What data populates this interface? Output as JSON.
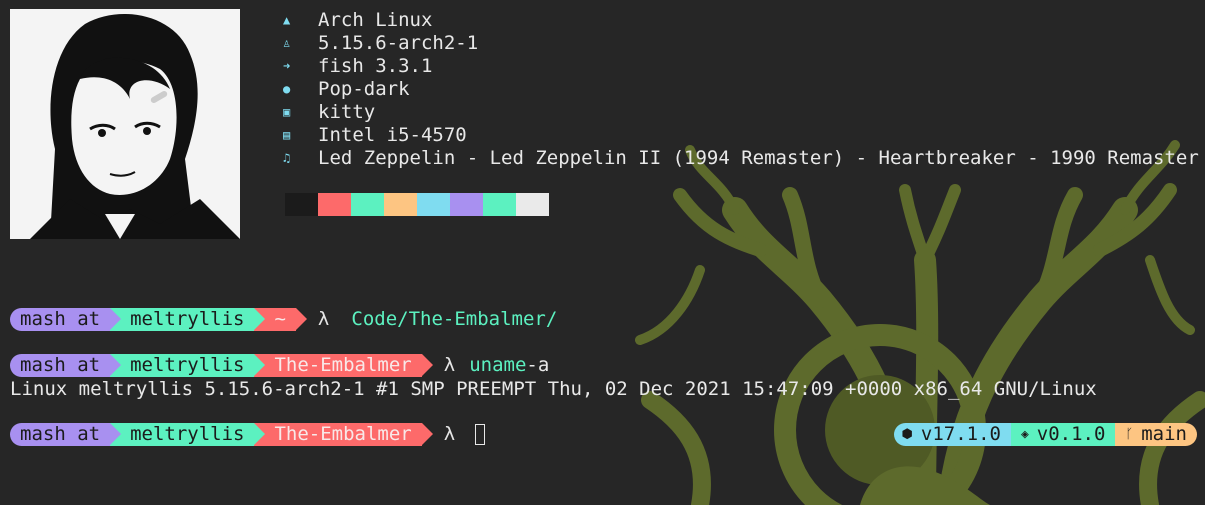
{
  "system_info": {
    "items": [
      {
        "icon": "arch-icon",
        "glyph": "▲",
        "text": "Arch Linux"
      },
      {
        "icon": "linux-penguin-icon",
        "glyph": "♙",
        "text": "5.15.6-arch2-1"
      },
      {
        "icon": "shell-arrow-icon",
        "glyph": "➜",
        "text": "fish 3.3.1"
      },
      {
        "icon": "palette-icon",
        "glyph": "●",
        "text": "Pop-dark"
      },
      {
        "icon": "terminal-icon",
        "glyph": "▣",
        "text": "kitty"
      },
      {
        "icon": "cpu-icon",
        "glyph": "▤",
        "text": "Intel i5-4570"
      },
      {
        "icon": "music-note-icon",
        "glyph": "♫",
        "text": "Led Zeppelin - Led Zeppelin II (1994 Remaster) - Heartbreaker - 1990 Remaster"
      }
    ]
  },
  "palette": [
    "#1b1b1b",
    "#fd6a6a",
    "#5cf1c0",
    "#fdc582",
    "#7fdcf0",
    "#a890f0",
    "#5cf1c0",
    "#eaeaea"
  ],
  "prompts": [
    {
      "user": "mash at",
      "host": "meltryllis",
      "dir": "~",
      "lambda": "λ",
      "cmd": "Code/The-Embalmer/",
      "arg": ""
    },
    {
      "user": "mash at",
      "host": "meltryllis",
      "dir": "The-Embalmer",
      "lambda": "λ",
      "cmd": "uname",
      "arg": " -a"
    },
    {
      "user": "mash at",
      "host": "meltryllis",
      "dir": "The-Embalmer",
      "lambda": "λ",
      "cmd": "",
      "arg": ""
    }
  ],
  "output": "Linux meltryllis 5.15.6-arch2-1 #1 SMP PREEMPT Thu, 02 Dec 2021 15:47:09 +0000 x86_64 GNU/Linux",
  "right_prompt": {
    "node_icon": "node-icon",
    "node_version": "v17.1.0",
    "package_icon": "package-icon",
    "package_version": "v0.1.0",
    "git_icon": "git-branch-icon",
    "git_branch": "main"
  },
  "colors": {
    "user": "#a890f0",
    "host": "#5cf1c0",
    "dir": "#fd6a6a",
    "accent": "#7fdcf0",
    "background": "#262626",
    "art": "#5d6a2c"
  }
}
